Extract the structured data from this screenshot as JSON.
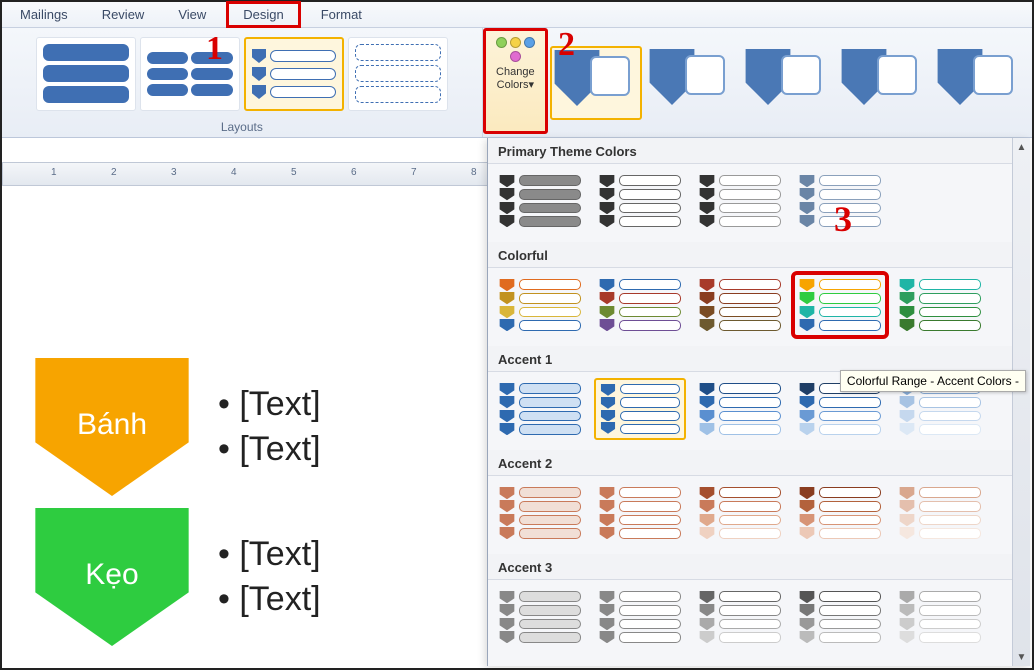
{
  "tabs": {
    "items": [
      "Mailings",
      "Review",
      "View",
      "Design",
      "Format"
    ],
    "highlight_index": 3
  },
  "ribbon": {
    "layouts_label": "Layouts",
    "change_colors_label_1": "Change",
    "change_colors_label_2": "Colors▾"
  },
  "annotations": {
    "a1": "1",
    "a2": "2",
    "a3": "3"
  },
  "smartart": {
    "nodes": [
      {
        "label": "Bánh",
        "bullets": [
          "[Text]",
          "[Text]"
        ],
        "color": "#f7a400"
      },
      {
        "label": "Kẹo",
        "bullets": [
          "[Text]",
          "[Text]"
        ],
        "color": "#2ecc40"
      }
    ]
  },
  "ruler": {
    "nums": [
      "1",
      "2",
      "3",
      "4",
      "5",
      "6",
      "7",
      "8"
    ]
  },
  "dropdown": {
    "sections": [
      {
        "title": "Primary Theme Colors",
        "swatches": [
          {
            "chev": [
              "#333",
              "#333",
              "#333",
              "#333"
            ],
            "bar_fill": "#8a8a8a",
            "bar_border": "#666"
          },
          {
            "chev": [
              "#333",
              "#333",
              "#333",
              "#333"
            ],
            "bar_fill": "#fff",
            "bar_border": "#666"
          },
          {
            "chev": [
              "#333",
              "#333",
              "#333",
              "#333"
            ],
            "bar_fill": "#fff",
            "bar_border": "#999"
          },
          {
            "chev": [
              "#6a85a6",
              "#6a85a6",
              "#6a85a6",
              "#6a85a6"
            ],
            "bar_fill": "#fff",
            "bar_border": "#8aa0bb"
          }
        ]
      },
      {
        "title": "Colorful",
        "swatches": [
          {
            "chev": [
              "#e06b1f",
              "#c2921f",
              "#d9b63a",
              "#2e6ab0"
            ],
            "bar_fill": "#fff",
            "bar_border_multi": [
              "#e06b1f",
              "#c2921f",
              "#d9b63a",
              "#2e6ab0"
            ]
          },
          {
            "chev": [
              "#2e6ab0",
              "#a83a2a",
              "#6d8a32",
              "#6e4e95"
            ],
            "bar_fill": "#fff",
            "bar_border_multi": [
              "#2e6ab0",
              "#a83a2a",
              "#6d8a32",
              "#6e4e95"
            ]
          },
          {
            "chev": [
              "#a83a2a",
              "#8a3d20",
              "#7a4c23",
              "#6d5a2f"
            ],
            "bar_fill": "#fff",
            "bar_border_multi": [
              "#a83a2a",
              "#8a3d20",
              "#7a4c23",
              "#6d5a2f"
            ]
          },
          {
            "chev": [
              "#f7a400",
              "#2ecc40",
              "#1fb5a6",
              "#2e6ab0"
            ],
            "bar_fill": "#fff",
            "bar_border_multi": [
              "#f7a400",
              "#2ecc40",
              "#1fb5a6",
              "#2e6ab0"
            ],
            "hl3": true
          },
          {
            "chev": [
              "#1fb5a6",
              "#2e9e5e",
              "#2e8f3f",
              "#3a7a2e"
            ],
            "bar_fill": "#fff",
            "bar_border_multi": [
              "#1fb5a6",
              "#2e9e5e",
              "#2e8f3f",
              "#3a7a2e"
            ]
          }
        ]
      },
      {
        "title": "Accent 1",
        "swatches": [
          {
            "chev": [
              "#2e6ab0",
              "#2e6ab0",
              "#2e6ab0",
              "#2e6ab0"
            ],
            "bar_fill": "#cfe0f3",
            "bar_border": "#2e6ab0"
          },
          {
            "chev": [
              "#2e6ab0",
              "#2e6ab0",
              "#2e6ab0",
              "#2e6ab0"
            ],
            "bar_fill": "#fff",
            "bar_border": "#2e6ab0",
            "sel": true
          },
          {
            "chev": [
              "#1f4e88",
              "#2e6ab0",
              "#5a8fd0",
              "#9fc1e6"
            ],
            "bar_fill": "#fff",
            "bar_border_multi": [
              "#1f4e88",
              "#2e6ab0",
              "#5a8fd0",
              "#9fc1e6"
            ]
          },
          {
            "chev": [
              "#1f3e66",
              "#2e6ab0",
              "#6a9ad4",
              "#b9d2ed"
            ],
            "bar_fill": "#fff",
            "bar_border_multi": [
              "#1f3e66",
              "#2e6ab0",
              "#6a9ad4",
              "#b9d2ed"
            ]
          },
          {
            "chev": [
              "#88acd6",
              "#a7c3e3",
              "#c5d8ee",
              "#dce8f5"
            ],
            "bar_fill": "#fff",
            "bar_border_multi": [
              "#88acd6",
              "#a7c3e3",
              "#c5d8ee",
              "#dce8f5"
            ]
          }
        ]
      },
      {
        "title": "Accent 2",
        "swatches": [
          {
            "chev": [
              "#c97a5a",
              "#c97a5a",
              "#c97a5a",
              "#c97a5a"
            ],
            "bar_fill": "#f1dfd6",
            "bar_border": "#c97a5a"
          },
          {
            "chev": [
              "#c97a5a",
              "#c97a5a",
              "#c97a5a",
              "#c97a5a"
            ],
            "bar_fill": "#fff",
            "bar_border": "#c97a5a"
          },
          {
            "chev": [
              "#a54f2e",
              "#c97a5a",
              "#e0a98c",
              "#efd1c1"
            ],
            "bar_fill": "#fff",
            "bar_border_multi": [
              "#a54f2e",
              "#c97a5a",
              "#e0a98c",
              "#efd1c1"
            ]
          },
          {
            "chev": [
              "#8a3d20",
              "#b3623c",
              "#d79476",
              "#ecc8b6"
            ],
            "bar_fill": "#fff",
            "bar_border_multi": [
              "#8a3d20",
              "#b3623c",
              "#d79476",
              "#ecc8b6"
            ]
          },
          {
            "chev": [
              "#d9a78e",
              "#e4bfad",
              "#eed6c9",
              "#f5e7df"
            ],
            "bar_fill": "#fff",
            "bar_border_multi": [
              "#d9a78e",
              "#e4bfad",
              "#eed6c9",
              "#f5e7df"
            ]
          }
        ]
      },
      {
        "title": "Accent 3",
        "swatches": [
          {
            "chev": [
              "#888",
              "#888",
              "#888",
              "#888"
            ],
            "bar_fill": "#ddd",
            "bar_border": "#888"
          },
          {
            "chev": [
              "#888",
              "#888",
              "#888",
              "#888"
            ],
            "bar_fill": "#fff",
            "bar_border": "#888"
          },
          {
            "chev": [
              "#666",
              "#888",
              "#aaa",
              "#ccc"
            ],
            "bar_fill": "#fff",
            "bar_border_multi": [
              "#666",
              "#888",
              "#aaa",
              "#ccc"
            ]
          },
          {
            "chev": [
              "#555",
              "#777",
              "#999",
              "#bbb"
            ],
            "bar_fill": "#fff",
            "bar_border_multi": [
              "#555",
              "#777",
              "#999",
              "#bbb"
            ]
          },
          {
            "chev": [
              "#aaa",
              "#bbb",
              "#ccc",
              "#ddd"
            ],
            "bar_fill": "#fff",
            "bar_border_multi": [
              "#aaa",
              "#bbb",
              "#ccc",
              "#ddd"
            ]
          }
        ]
      }
    ]
  },
  "tooltip_text": "Colorful Range - Accent Colors -"
}
